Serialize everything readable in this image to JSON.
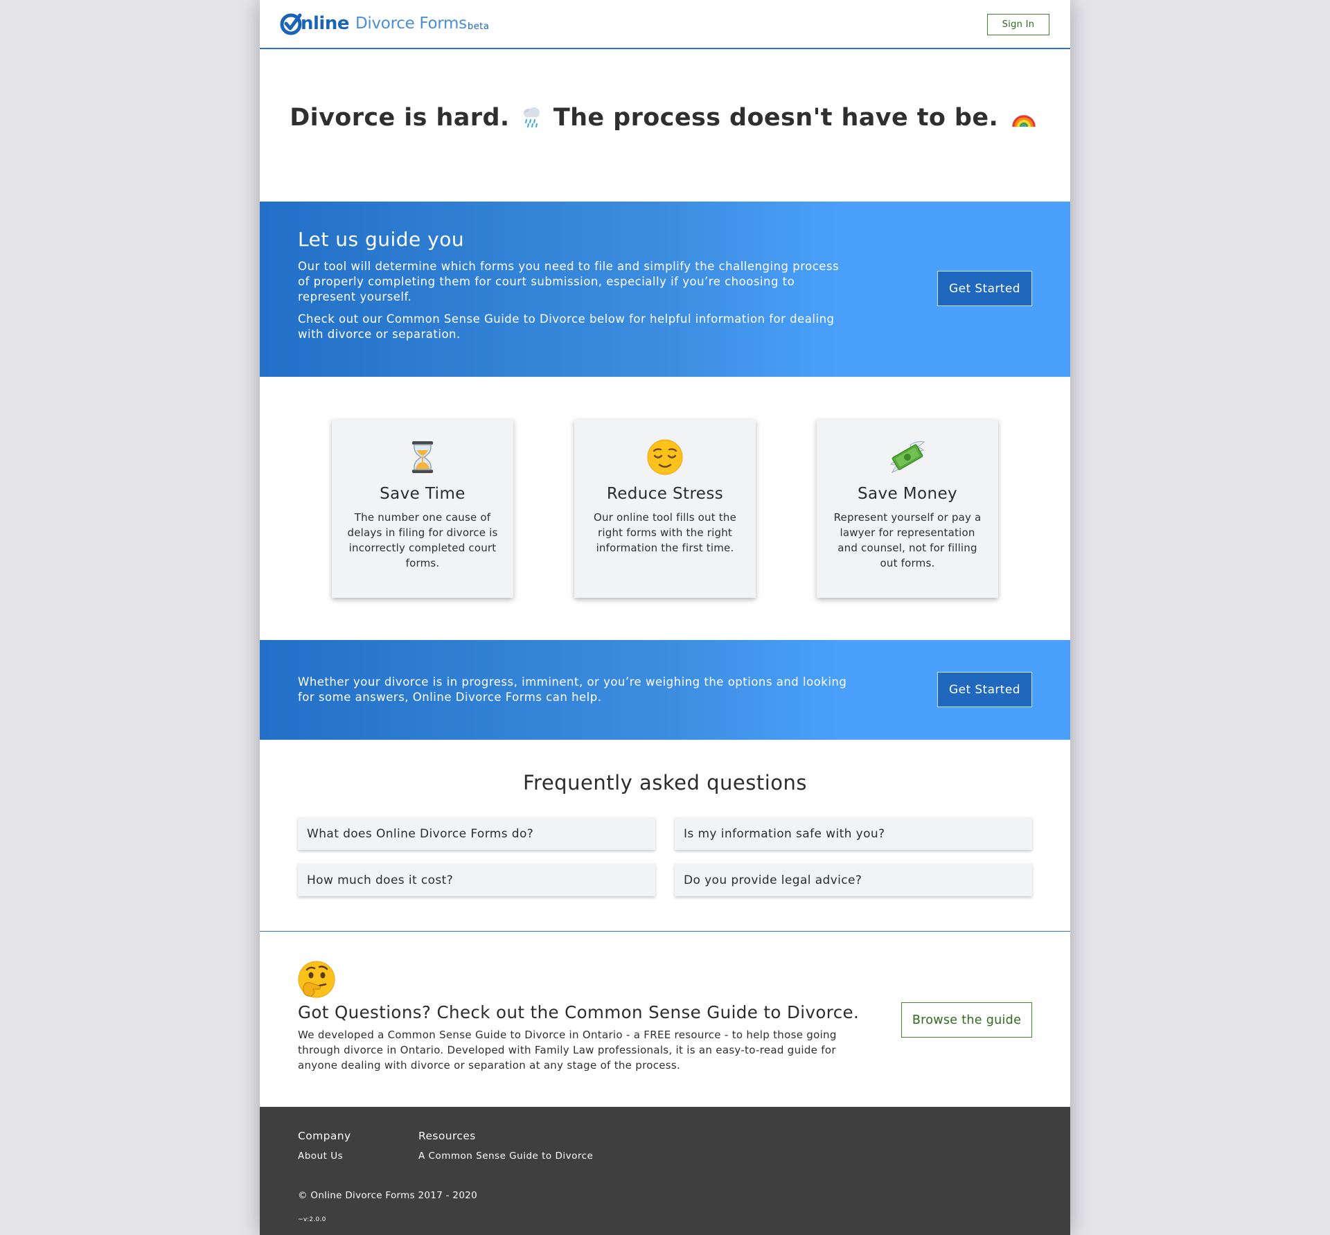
{
  "header": {
    "logo_strong": "nline",
    "logo_light": "Divorce Forms",
    "beta": "beta",
    "signin": "Sign In"
  },
  "hero": {
    "part1": "Divorce is hard.",
    "emoji1": "rain-cloud-icon",
    "part2": "The process doesn't have to be.",
    "emoji2": "rainbow-icon"
  },
  "guide_band": {
    "title": "Let us guide you",
    "p1": "Our tool will determine which forms you need to file and simplify the challenging process of properly completing them for court submission, especially if you’re choosing to represent yourself.",
    "p2": "Check out our Common Sense Guide to Divorce below for helpful information for dealing with divorce or separation.",
    "button": "Get Started"
  },
  "features": [
    {
      "icon": "hourglass-icon",
      "title": "Save Time",
      "text": "The number one cause of delays in filing for divorce is incorrectly completed court forms."
    },
    {
      "icon": "relieved-face-icon",
      "title": "Reduce Stress",
      "text": "Our online tool fills out the right forms with the right information the first time."
    },
    {
      "icon": "money-with-wings-icon",
      "title": "Save Money",
      "text": "Represent yourself or pay a lawyer for representation and counsel, not for filling out forms."
    }
  ],
  "cta_band": {
    "text": "Whether your divorce is in progress, imminent, or you’re weighing the options and looking for some answers, Online Divorce Forms can help.",
    "button": "Get Started"
  },
  "faq": {
    "title": "Frequently asked questions",
    "items": [
      "What does Online Divorce Forms do?",
      "Is my information safe with you?",
      "How much does it cost?",
      "Do you provide legal advice?"
    ]
  },
  "guide": {
    "icon": "thinking-face-icon",
    "title": "Got Questions? Check out the Common Sense Guide to Divorce.",
    "text": "We developed a Common Sense Guide to Divorce in Ontario - a FREE resource - to help those going through divorce in Ontario. Developed with Family Law professionals, it is an easy-to-read guide for anyone dealing with divorce or separation at any stage of the process.",
    "button": "Browse the guide"
  },
  "footer": {
    "company_heading": "Company",
    "about_link": "About Us",
    "resources_heading": "Resources",
    "guide_link": "A Common Sense Guide to Divorce",
    "copyright": "© Online Divorce Forms 2017 - 2020",
    "version": "~v:2.0.0"
  },
  "colors": {
    "brand_blue": "#1a64b8",
    "band_gradient_start": "#2270c7",
    "band_gradient_end": "#4aa0fa",
    "button_blue": "#1f68bd",
    "green_outline": "#3d8a2a",
    "footer_bg": "#3f3f3f",
    "page_bg": "#e4e4e9",
    "card_bg": "#f2f3f5"
  }
}
